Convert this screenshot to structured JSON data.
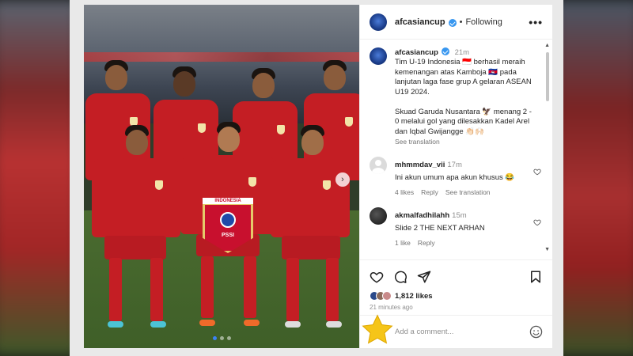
{
  "post": {
    "username": "afcasiancup",
    "follow_status": "Following",
    "separator": "•",
    "more": "•••",
    "caption_time": "21m",
    "caption": "Tim U-19 Indonesia 🇮🇩 berhasil meraih kemenangan atas Kamboja 🇰🇭 pada lanjutan laga fase grup A gelaran ASEAN U19 2024.\n\nSkuad Garuda Nusantara 🦅 menang 2 - 0 melalui gol yang dilesakkan Kadel Arel dan Iqbal Gwijangge 👏🏻🙌🏻",
    "see_translation": "See translation"
  },
  "photo": {
    "pennant_top": "INDONESIA",
    "pennant_bottom": "PSSI",
    "next_icon": "›",
    "slide_count": 3,
    "active_slide": 1
  },
  "comments": [
    {
      "username": "mhmmdav_vii",
      "time": "17m",
      "text": "Ini akun umum apa akun khusus 😂",
      "likes": "4 likes",
      "reply": "Reply",
      "translation": "See translation"
    },
    {
      "username": "akmalfadhilahh",
      "time": "15m",
      "text": "Slide 2 THE NEXT ARHAN",
      "likes": "1 like",
      "reply": "Reply"
    }
  ],
  "stats": {
    "likes": "1,812 likes",
    "posted": "21 minutes ago"
  },
  "comment_box": {
    "placeholder": "Add a comment..."
  },
  "colors": {
    "verified": "#3897f0",
    "jersey": "#c41e24",
    "star": "#f5c518"
  }
}
